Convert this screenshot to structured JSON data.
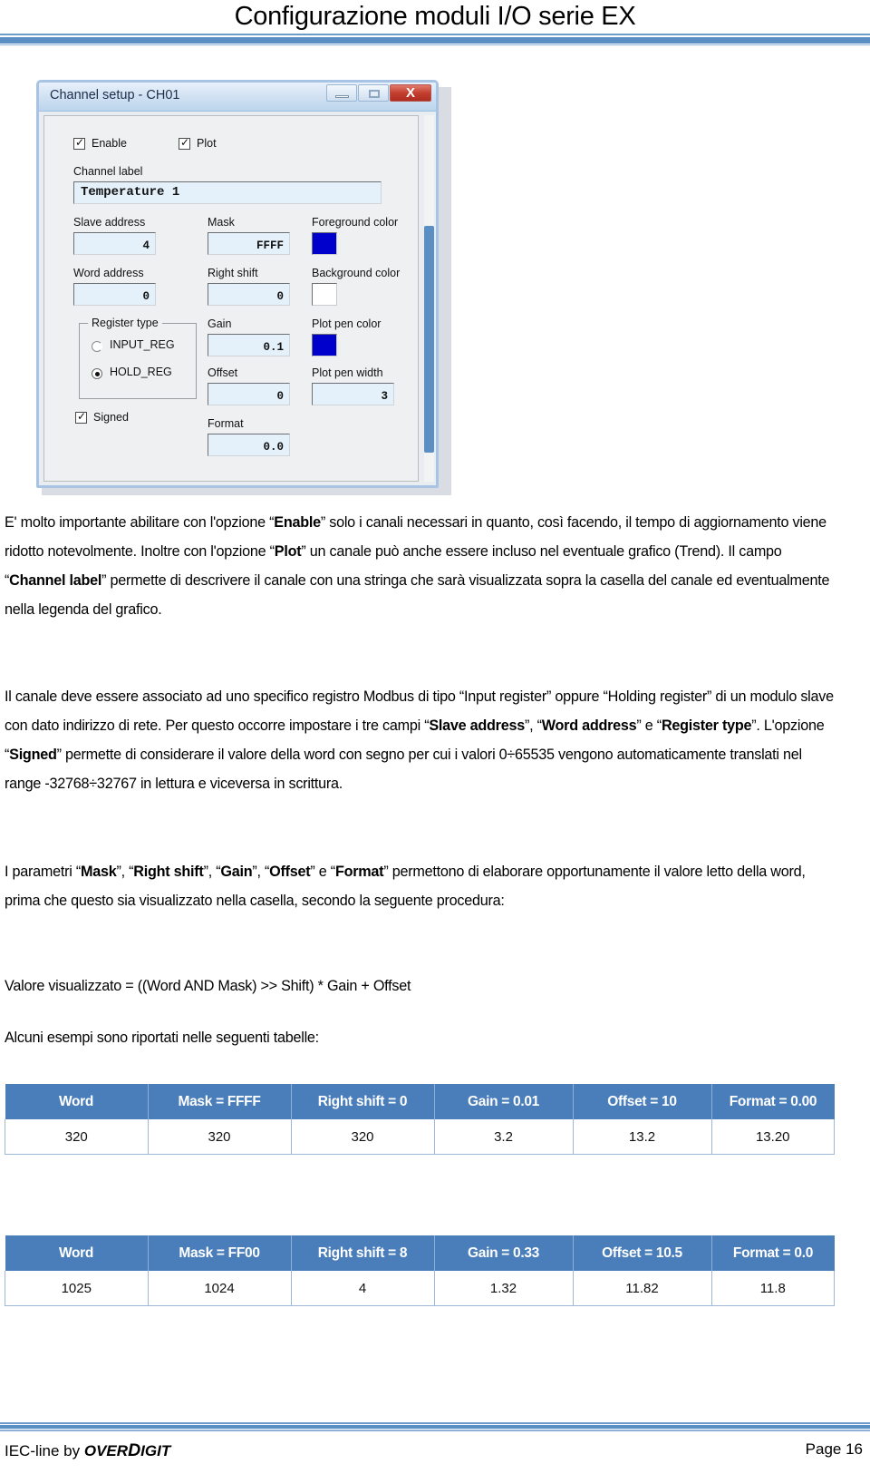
{
  "header": {
    "title": "Configurazione moduli I/O serie EX"
  },
  "dialog": {
    "title": "Channel setup - CH01",
    "window_buttons": {
      "minimize": "minimize-button",
      "maximize": "maximize-button",
      "close": "X"
    },
    "checkbox_enable": {
      "label": "Enable",
      "checked": true
    },
    "checkbox_plot": {
      "label": "Plot",
      "checked": true
    },
    "channel_label": {
      "label": "Channel label",
      "value": "Temperature 1"
    },
    "slave_address": {
      "label": "Slave address",
      "value": "4"
    },
    "word_address": {
      "label": "Word address",
      "value": "0"
    },
    "mask": {
      "label": "Mask",
      "value": "FFFF"
    },
    "right_shift": {
      "label": "Right shift",
      "value": "0"
    },
    "gain": {
      "label": "Gain",
      "value": "0.1"
    },
    "offset": {
      "label": "Offset",
      "value": "0"
    },
    "format": {
      "label": "Format",
      "value": "0.0"
    },
    "register_type": {
      "legend": "Register type",
      "options": [
        {
          "label": "INPUT_REG",
          "selected": false
        },
        {
          "label": "HOLD_REG",
          "selected": true
        }
      ]
    },
    "checkbox_signed": {
      "label": "Signed",
      "checked": true
    },
    "foreground_color": {
      "label": "Foreground color",
      "value": "#0000cc"
    },
    "background_color": {
      "label": "Background color",
      "value": "#ffffff"
    },
    "plot_pen_color": {
      "label": "Plot pen color",
      "value": "#0000cc"
    },
    "plot_pen_width": {
      "label": "Plot pen width",
      "value": "3"
    }
  },
  "paragraphs": {
    "p1_a": "E' molto importante abilitare con l'opzione “",
    "p1_b": "Enable",
    "p1_c": "” solo i canali necessari in quanto, così facendo, il tempo di aggiornamento viene ridotto notevolmente. Inoltre con l'opzione “",
    "p1_d": "Plot",
    "p1_e": "” un canale può anche essere incluso nel eventuale grafico (Trend). Il campo “",
    "p1_f": "Channel label",
    "p1_g": "” permette di descrivere il canale con una stringa che sarà visualizzata sopra la casella del canale ed eventualmente nella legenda del grafico.",
    "p2_a": "Il canale deve essere associato ad uno specifico registro Modbus di tipo “Input register” oppure “Holding register” di un modulo slave con dato indirizzo di rete. Per questo occorre impostare i tre campi “",
    "p2_b": "Slave address",
    "p2_c": "”, “",
    "p2_d": "Word address",
    "p2_e": "” e “",
    "p2_f": "Register type",
    "p2_g": "”. L'opzione “",
    "p2_h": "Signed",
    "p2_i": "” permette di considerare il valore della word con segno per cui i valori 0÷65535 vengono automaticamente translati nel range -32768÷32767 in lettura e viceversa in scrittura.",
    "p3_a": "I parametri “",
    "p3_b": "Mask",
    "p3_c": "”, “",
    "p3_d": "Right shift",
    "p3_e": "”, “",
    "p3_f": "Gain",
    "p3_g": "”, “",
    "p3_h": "Offset",
    "p3_i": "” e “",
    "p3_j": "Format",
    "p3_k": "” permettono di elaborare opportunamente il valore letto della word, prima che questo sia visualizzato nella casella, secondo la seguente procedura:",
    "formula": "Valore visualizzato = ((Word AND Mask) >> Shift) * Gain + Offset",
    "p4": "Alcuni esempi sono riportati nelle seguenti tabelle:"
  },
  "tables": [
    {
      "headers": [
        "Word",
        "Mask = FFFF",
        "Right shift = 0",
        "Gain = 0.01",
        "Offset = 10",
        "Format = 0.00"
      ],
      "rows": [
        [
          "320",
          "320",
          "320",
          "3.2",
          "13.2",
          "13.20"
        ]
      ]
    },
    {
      "headers": [
        "Word",
        "Mask = FF00",
        "Right shift = 8",
        "Gain = 0.33",
        "Offset = 10.5",
        "Format = 0.0"
      ],
      "rows": [
        [
          "1025",
          "1024",
          "4",
          "1.32",
          "11.82",
          "11.8"
        ]
      ]
    }
  ],
  "footer": {
    "left_prefix": "IEC-line by ",
    "brand_over": "OVER",
    "brand_d": "D",
    "brand_igit": "IGIT",
    "page": "Page 16"
  }
}
